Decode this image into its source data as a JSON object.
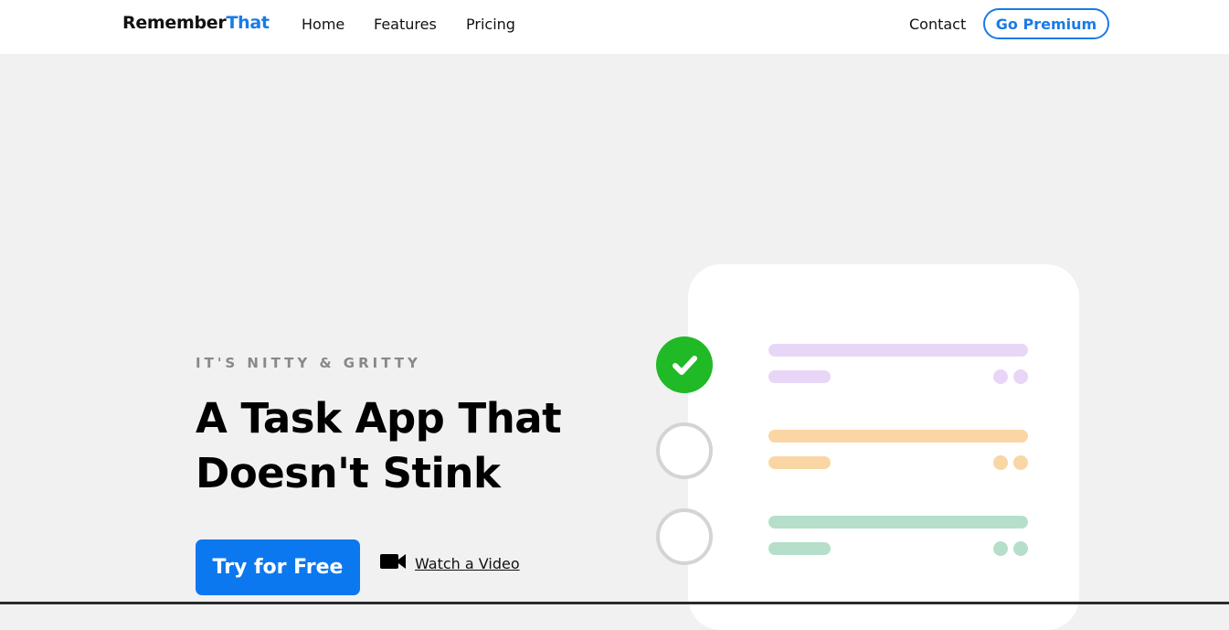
{
  "brand": {
    "part1": "Remember",
    "part2": "That"
  },
  "nav": {
    "items": [
      "Home",
      "Features",
      "Pricing"
    ],
    "contact": "Contact",
    "premium": "Go Premium"
  },
  "hero": {
    "eyebrow": "IT'S NITTY & GRITTY",
    "headline_line1": "A Task App That",
    "headline_line2": "Doesn't Stink",
    "cta": "Try for Free",
    "video_link": "Watch a Video"
  },
  "colors": {
    "accent": "#1a7be6",
    "cta": "#0b78f0",
    "check": "#1fba25",
    "task_purple": "#e8d6f6",
    "task_orange": "#fad6a5",
    "task_green": "#b5dfca"
  },
  "illustration": {
    "tasks": [
      {
        "state": "done",
        "color": "#e8d6f6"
      },
      {
        "state": "todo",
        "color": "#fad6a5"
      },
      {
        "state": "todo",
        "color": "#b5dfca"
      }
    ]
  }
}
